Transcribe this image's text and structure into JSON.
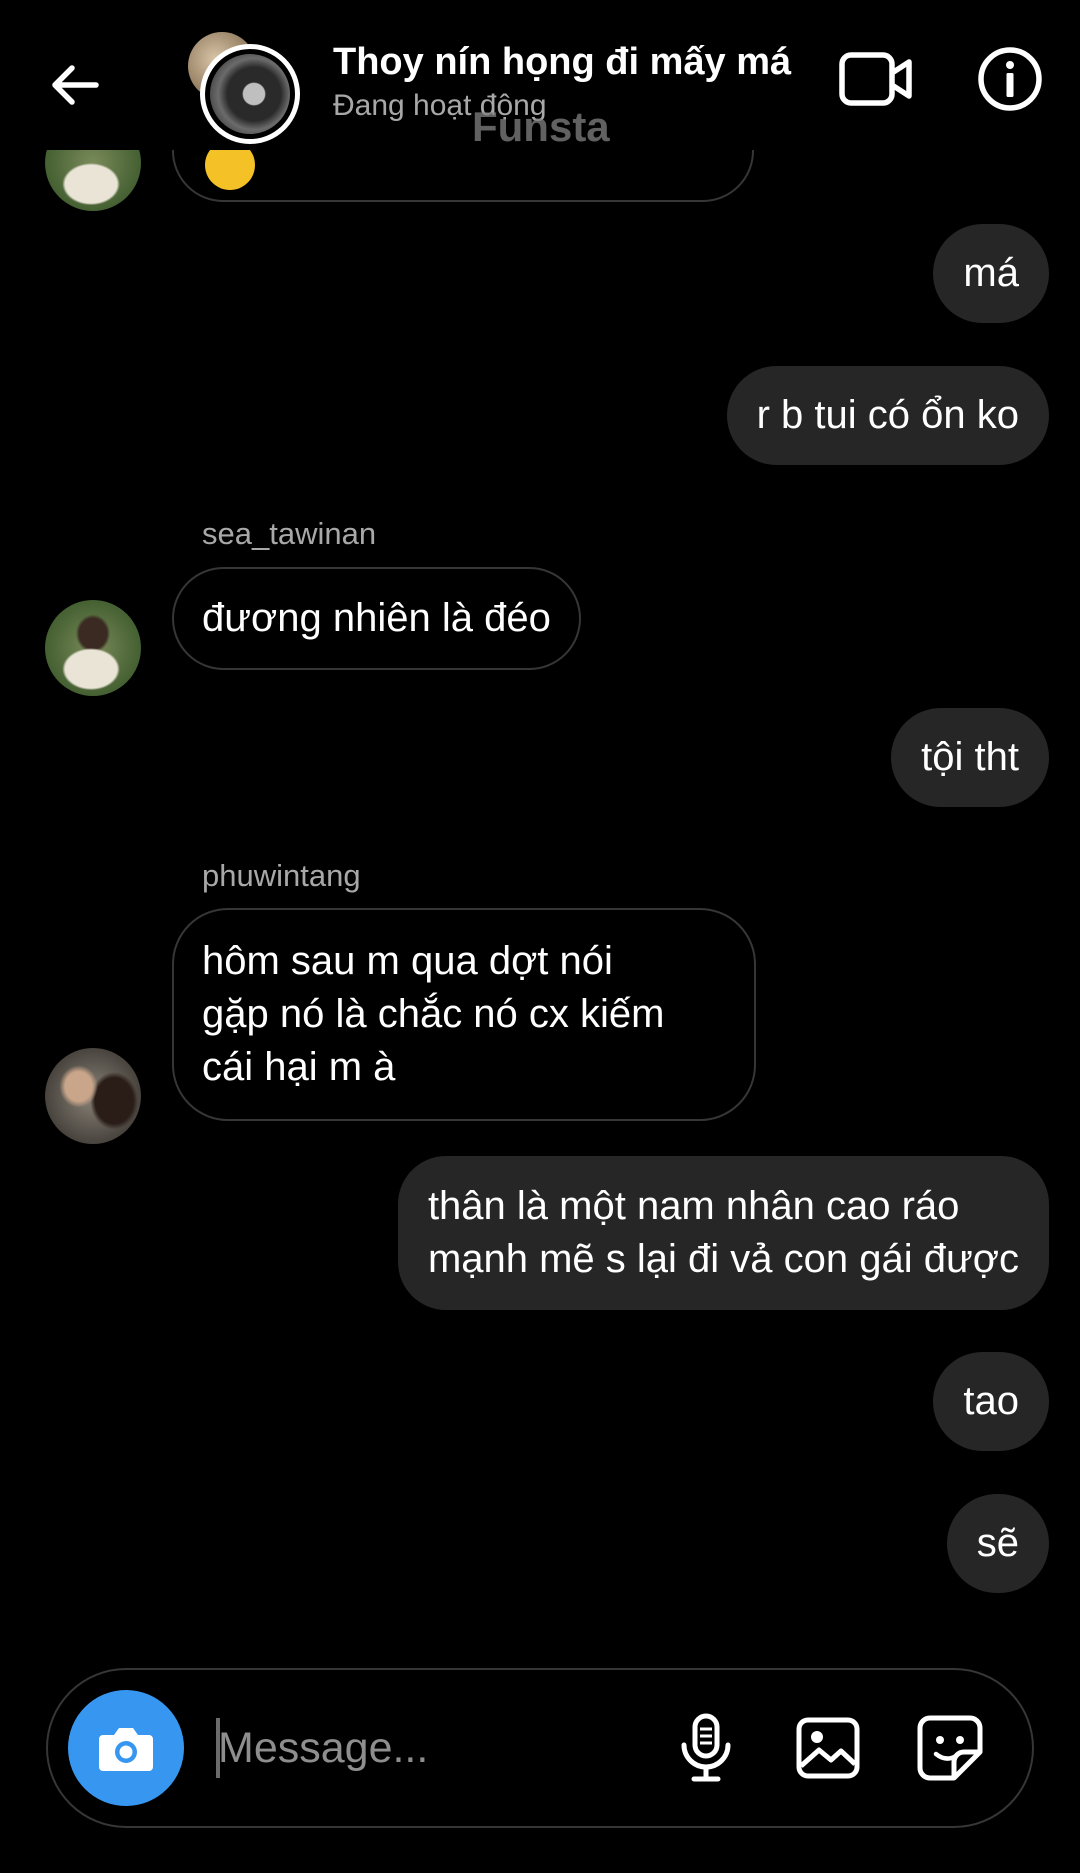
{
  "header": {
    "title": "Thoy nín họng đi mấy má",
    "status": "Đang hoạt động",
    "watermark": "Funsta",
    "icons": {
      "back": "back-arrow-icon",
      "video": "video-call-icon",
      "info": "info-icon"
    }
  },
  "messages": [
    {
      "direction": "outgoing",
      "text": "má"
    },
    {
      "direction": "outgoing",
      "text": "r b tui có ổn ko"
    },
    {
      "direction": "incoming",
      "sender": "sea_tawinan",
      "text": "đương nhiên là đéo"
    },
    {
      "direction": "outgoing",
      "text": "tội tht"
    },
    {
      "direction": "incoming",
      "sender": "phuwintang",
      "lines": [
        "hôm sau m qua dợt nói",
        "gặp nó là chắc nó cx kiếm",
        "cái hại m à"
      ]
    },
    {
      "direction": "outgoing",
      "lines": [
        "thân là một nam nhân cao ráo",
        "mạnh mẽ s lại đi vả con gái được"
      ]
    },
    {
      "direction": "outgoing",
      "text": "tao"
    },
    {
      "direction": "outgoing",
      "text": "sẽ"
    }
  ],
  "composer": {
    "placeholder": "Message...",
    "icons": {
      "camera": "camera-icon",
      "mic": "microphone-icon",
      "gallery": "gallery-icon",
      "sticker": "sticker-icon"
    },
    "accent": "#3797f0"
  },
  "colors": {
    "background": "#000000",
    "outgoing_bubble": "#262626",
    "incoming_border": "#363636",
    "secondary_text": "#a8a8a8"
  }
}
